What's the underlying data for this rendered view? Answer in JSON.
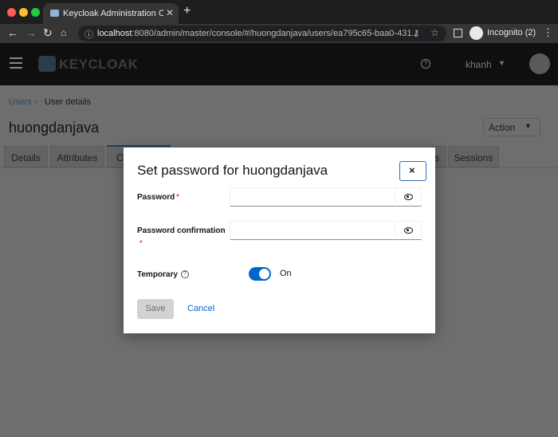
{
  "browser": {
    "tab_title": "Keycloak Administration Console",
    "url_host": "localhost",
    "url_rest": ":8080/admin/master/console/#/huongdanjava/users/ea795c65-baa0-431...",
    "incognito_label": "Incognito (2)",
    "icons": [
      "back-arrow",
      "forward-arrow",
      "reload",
      "home",
      "info",
      "key",
      "star",
      "side-panel",
      "incognito",
      "more-vert"
    ]
  },
  "header": {
    "logo_text": "KEYCLOAK",
    "help_symbol": "?",
    "username": "khanh"
  },
  "breadcrumb": {
    "parent": "Users",
    "current": "User details"
  },
  "page": {
    "title": "huongdanjava",
    "action_label": "Action"
  },
  "tabs": [
    {
      "label": "Details"
    },
    {
      "label": "Attributes"
    },
    {
      "label": "C"
    },
    {
      "label": "s"
    },
    {
      "label": "Sessions"
    }
  ],
  "modal": {
    "title": "Set password for huongdanjava",
    "close_symbol": "×",
    "password_label": "Password",
    "password_value": "",
    "confirm_label": "Password confirmation",
    "confirm_value": "",
    "required_mark": "*",
    "temporary_label": "Temporary",
    "temporary_help": "?",
    "temporary_state": "On",
    "save_label": "Save",
    "cancel_label": "Cancel"
  },
  "colors": {
    "primary": "#0066cc",
    "required": "#c9190b",
    "disabled": "#d2d2d2"
  }
}
